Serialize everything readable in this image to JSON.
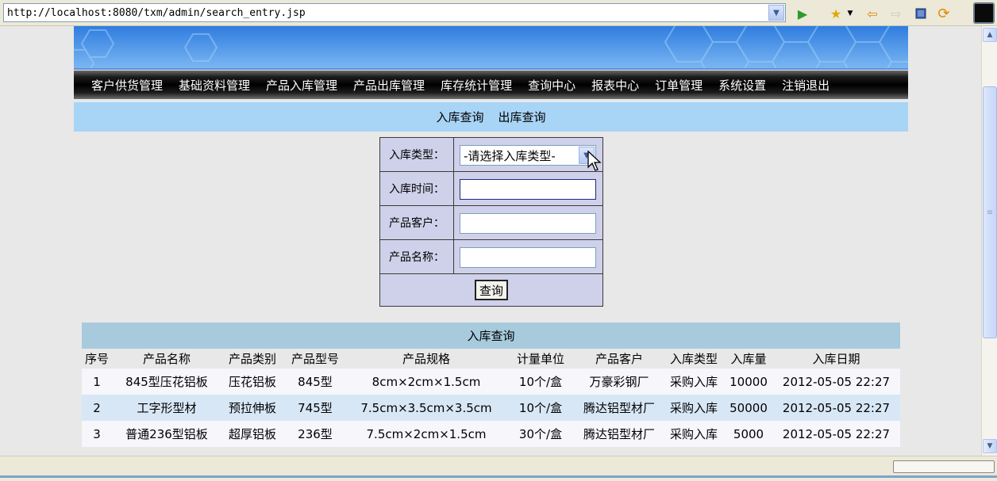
{
  "browser": {
    "url": "http://localhost:8080/txm/admin/search_entry.jsp"
  },
  "nav": {
    "items": [
      "客户供货管理",
      "基础资料管理",
      "产品入库管理",
      "产品出库管理",
      "库存统计管理",
      "查询中心",
      "报表中心",
      "订单管理",
      "系统设置",
      "注销退出"
    ]
  },
  "subnav": {
    "entry_query": "入库查询",
    "exit_query": "出库查询"
  },
  "form": {
    "entry_type_label": "入库类型：",
    "entry_type_value": "-请选择入库类型-",
    "entry_time_label": "入库时间：",
    "entry_time_value": "",
    "customer_label": "产品客户：",
    "customer_value": "",
    "product_name_label": "产品名称：",
    "product_name_value": "",
    "query_button": "查询"
  },
  "results": {
    "title": "入库查询",
    "columns": [
      "序号",
      "产品名称",
      "产品类别",
      "产品型号",
      "产品规格",
      "计量单位",
      "产品客户",
      "入库类型",
      "入库量",
      "入库日期"
    ],
    "rows": [
      [
        "1",
        "845型压花铝板",
        "压花铝板",
        "845型",
        "8cm×2cm×1.5cm",
        "10个/盒",
        "万豪彩钢厂",
        "采购入库",
        "10000",
        "2012-05-05 22:27"
      ],
      [
        "2",
        "工字形型材",
        "预拉伸板",
        "745型",
        "7.5cm×3.5cm×3.5cm",
        "10个/盒",
        "腾达铝型材厂",
        "采购入库",
        "50000",
        "2012-05-05 22:27"
      ],
      [
        "3",
        "普通236型铝板",
        "超厚铝板",
        "236型",
        "7.5cm×2cm×1.5cm",
        "30个/盒",
        "腾达铝型材厂",
        "采购入库",
        "5000",
        "2012-05-05 22:27"
      ]
    ]
  },
  "colors": {
    "nav_bg": "#000000",
    "subnav_bg": "#a8d4f6",
    "form_bg": "#cfd1ea",
    "table_title_bg": "#a7cbdd",
    "row_even_bg": "#d8e7f6"
  }
}
